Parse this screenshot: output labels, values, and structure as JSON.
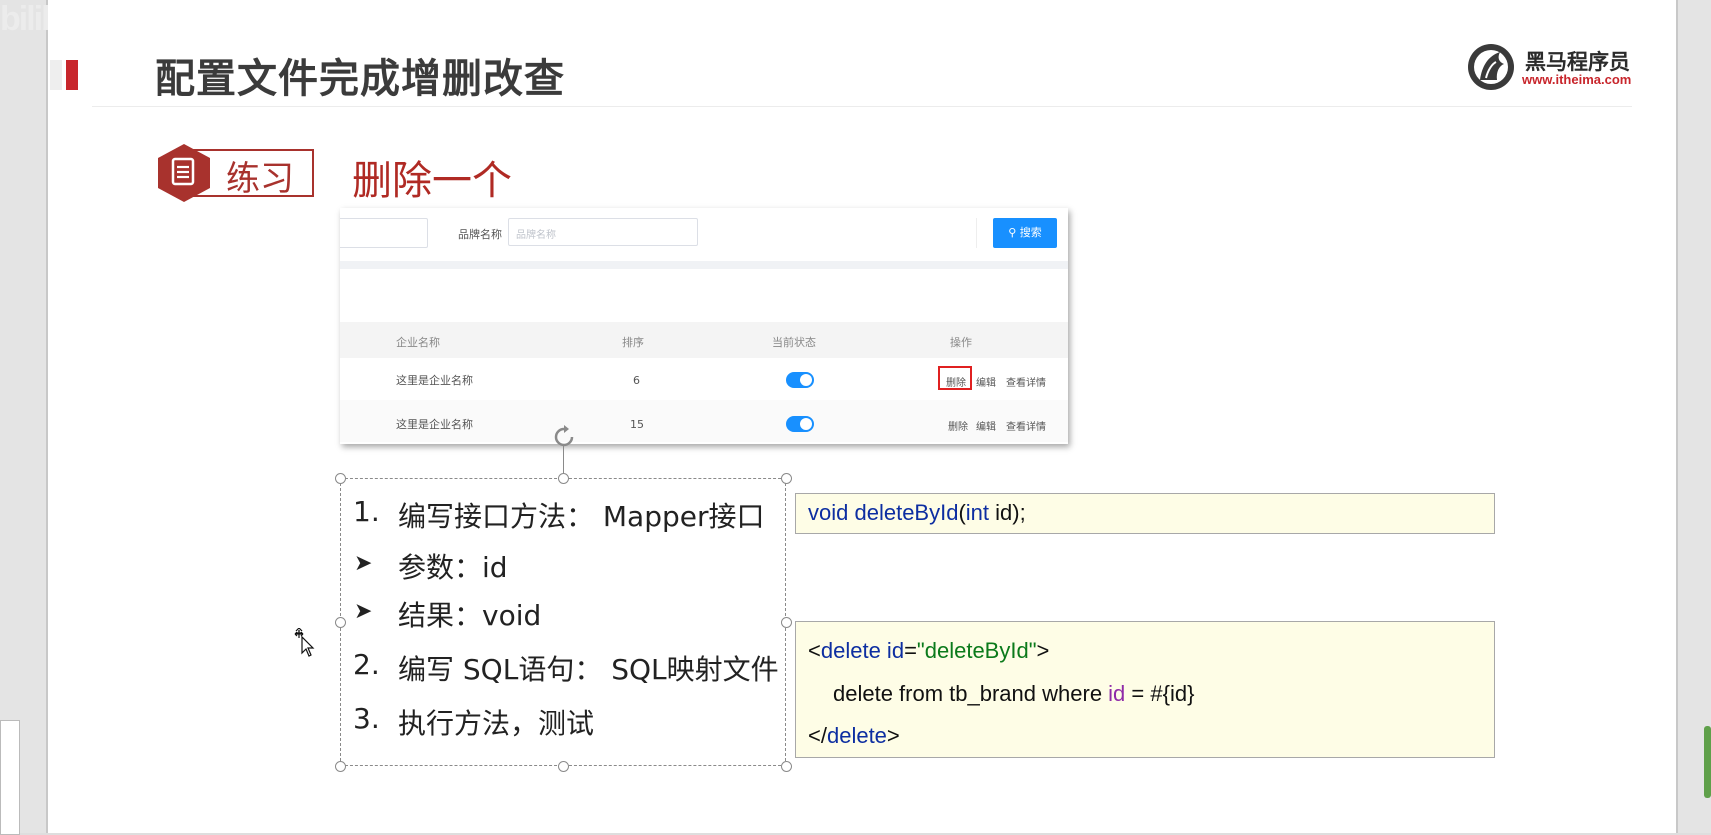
{
  "slide": {
    "title": "配置文件完成增删改查",
    "logo": {
      "name": "黑马程序员",
      "url": "www.itheima.com"
    },
    "badge_label": "练习",
    "exercise_title": "删除一个"
  },
  "mock_ui": {
    "brand_label": "品牌名称",
    "brand_placeholder": "品牌名称",
    "search_button": "搜索",
    "columns": [
      "企业名称",
      "排序",
      "当前状态",
      "操作"
    ],
    "rows": [
      {
        "company": "这里是企业名称",
        "order": "6",
        "status_on": true
      },
      {
        "company": "这里是企业名称",
        "order": "15",
        "status_on": true
      }
    ],
    "actions": {
      "delete": "删除",
      "edit": "编辑",
      "detail": "查看详情"
    }
  },
  "steps": {
    "s1_num": "1.",
    "s1_text": "编写接口方法： Mapper接口",
    "b1": "参数：id",
    "b2": "结果：void",
    "s2_num": "2.",
    "s2_text": "编写 SQL语句： SQL映射文件",
    "s3_num": "3.",
    "s3_text": "执行方法，测试"
  },
  "code": {
    "java": {
      "kw_void": "void",
      "fn_name": "deleteById",
      "open_paren": "(",
      "kw_int": "int",
      "rest": " id);"
    },
    "xml": {
      "line1_lt": "<",
      "line1_tag": "delete",
      "line1_attr": " id",
      "line1_eq": "=",
      "line1_val": "\"deleteById\"",
      "line1_gt": ">",
      "line2_a": "delete from tb_brand where ",
      "line2_id": "id",
      "line2_b": " = #{id}",
      "line3_lt": "</",
      "line3_tag": "delete",
      "line3_gt": ">"
    }
  },
  "colors": {
    "accent_red": "#c8262c",
    "primary_blue": "#1890ff",
    "code_bg": "#fefde6"
  },
  "watermark": "bilibili"
}
